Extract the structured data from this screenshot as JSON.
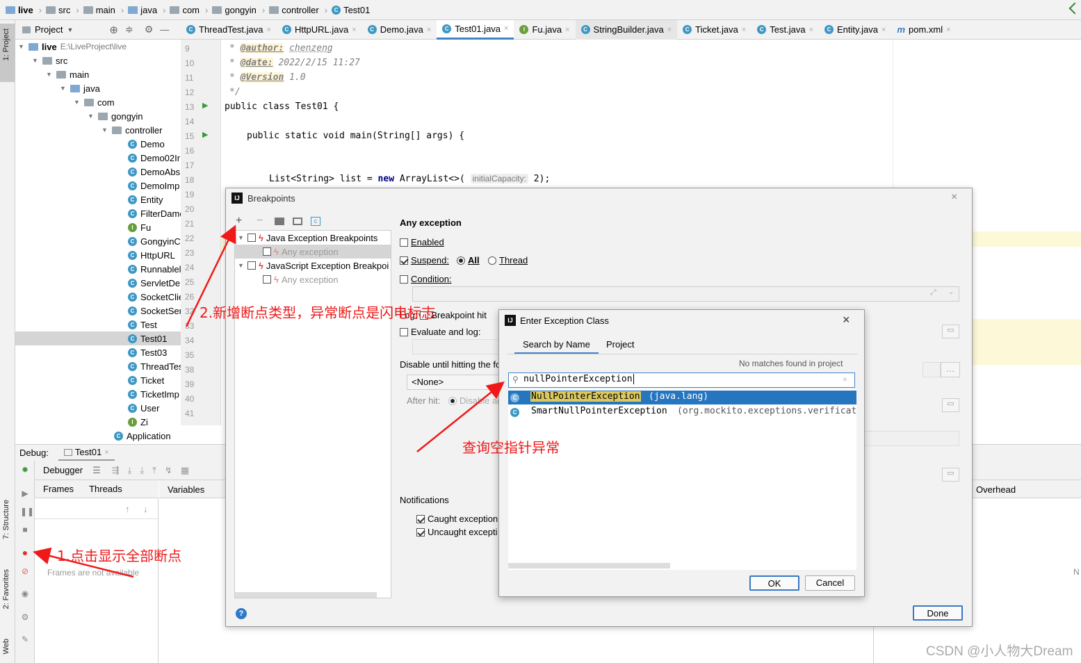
{
  "breadcrumbs": [
    "live",
    "src",
    "main",
    "java",
    "com",
    "gongyin",
    "controller",
    "Test01"
  ],
  "project": {
    "title": "Project",
    "root_name": "live",
    "root_path": "E:\\LiveProject\\live",
    "folders": [
      "src",
      "main",
      "java",
      "com",
      "gongyin",
      "controller"
    ],
    "classes": [
      "Demo",
      "Demo02Ir",
      "DemoAbs",
      "DemoImp",
      "Entity",
      "FilterDamo",
      "Fu",
      "GongyinC",
      "HttpURL",
      "Runnablel",
      "ServletDer",
      "SocketClie",
      "SocketSer",
      "Test",
      "Test01",
      "Test03",
      "ThreadTes",
      "Ticket",
      "TicketImp",
      "User",
      "Zi",
      "Application"
    ]
  },
  "left_strip": {
    "project_tab": "1: Project",
    "structure_tab": "7: Structure",
    "favorites_tab": "2: Favorites",
    "web_tab": "Web"
  },
  "tabs": [
    "ThreadTest.java",
    "HttpURL.java",
    "Demo.java",
    "Test01.java",
    "Fu.java",
    "StringBuilder.java",
    "Ticket.java",
    "Test.java",
    "Entity.java",
    "pom.xml"
  ],
  "editor": {
    "line_numbers": [
      "9",
      "10",
      "11",
      "12",
      "13",
      "14",
      "15",
      "16",
      "17",
      "18",
      "19",
      "20",
      "21",
      "22",
      "23",
      "24",
      "25",
      "26",
      "32",
      "33",
      "34",
      "35",
      "38",
      "39",
      "40",
      "41"
    ],
    "author_tag": "@author:",
    "author_value": "chenzeng",
    "date_tag": "@date:",
    "date_value": "2022/2/15 11:27",
    "version_tag": "@Version",
    "version_value": "1.0",
    "class_decl": "public class Test01 {",
    "main_decl": "public static void main(String[] args) {",
    "list_prefix": "List<String> list = ",
    "list_new": "new",
    "list_type": " ArrayList<>(",
    "list_hint": "initialCapacity:",
    "list_suffix": " 2);"
  },
  "debug": {
    "label": "Debug:",
    "session_tab": "Test01",
    "debugger_tab": "Debugger",
    "frames_tab": "Frames",
    "threads_tab": "Threads",
    "variables_tab": "Variables",
    "frames_empty": "Frames are not available",
    "overhead_tab": "Overhead",
    "n_label": "N"
  },
  "breakpoints_dialog": {
    "title": "Breakpoints",
    "tree": {
      "java_group": "Java Exception Breakpoints",
      "java_child": "Any exception",
      "js_group": "JavaScript Exception Breakpoi",
      "js_child": "Any exception"
    },
    "section_title": "Any exception",
    "enabled_label": "Enabled",
    "suspend_label": "Suspend:",
    "suspend_all": "All",
    "suspend_thread": "Thread",
    "condition_label": "Condition:",
    "log_label": "Log:",
    "log_hit_label": "Breakpoint hit",
    "evaluate_label": "Evaluate and log:",
    "disable_until_label": "Disable until hitting the fo",
    "none_option": "<None>",
    "after_hit_label": "After hit:",
    "disable_again_label": "Disable ag",
    "notifications_label": "Notifications",
    "caught_label": "Caught exception",
    "uncaught_label": "Uncaught excepti",
    "done_button": "Done",
    "help_icon": "?"
  },
  "exception_dialog": {
    "title": "Enter Exception Class",
    "tab_search_by_name": "Search by Name",
    "tab_project": "Project",
    "no_matches": "No matches found in project",
    "search_value": "nullPointerException",
    "results": [
      {
        "name": "NullPointerException",
        "package": "(java.lang)",
        "selected": true
      },
      {
        "name": "SmartNullPointerException",
        "package": "(org.mockito.exceptions.verificat",
        "selected": false
      }
    ],
    "ok_button": "OK",
    "cancel_button": "Cancel"
  },
  "annotations": {
    "step1": "1.点击显示全部断点",
    "step2": "2.新增断点类型，异常断点是闪电标志",
    "step3": "查询空指针异常"
  },
  "watermark": "CSDN @小人物大Dream",
  "colors": {
    "accent": "#3a79c4",
    "selection": "#2675bf",
    "annotation": "#f01818",
    "highlight_yellow": "#fcf8d8"
  }
}
